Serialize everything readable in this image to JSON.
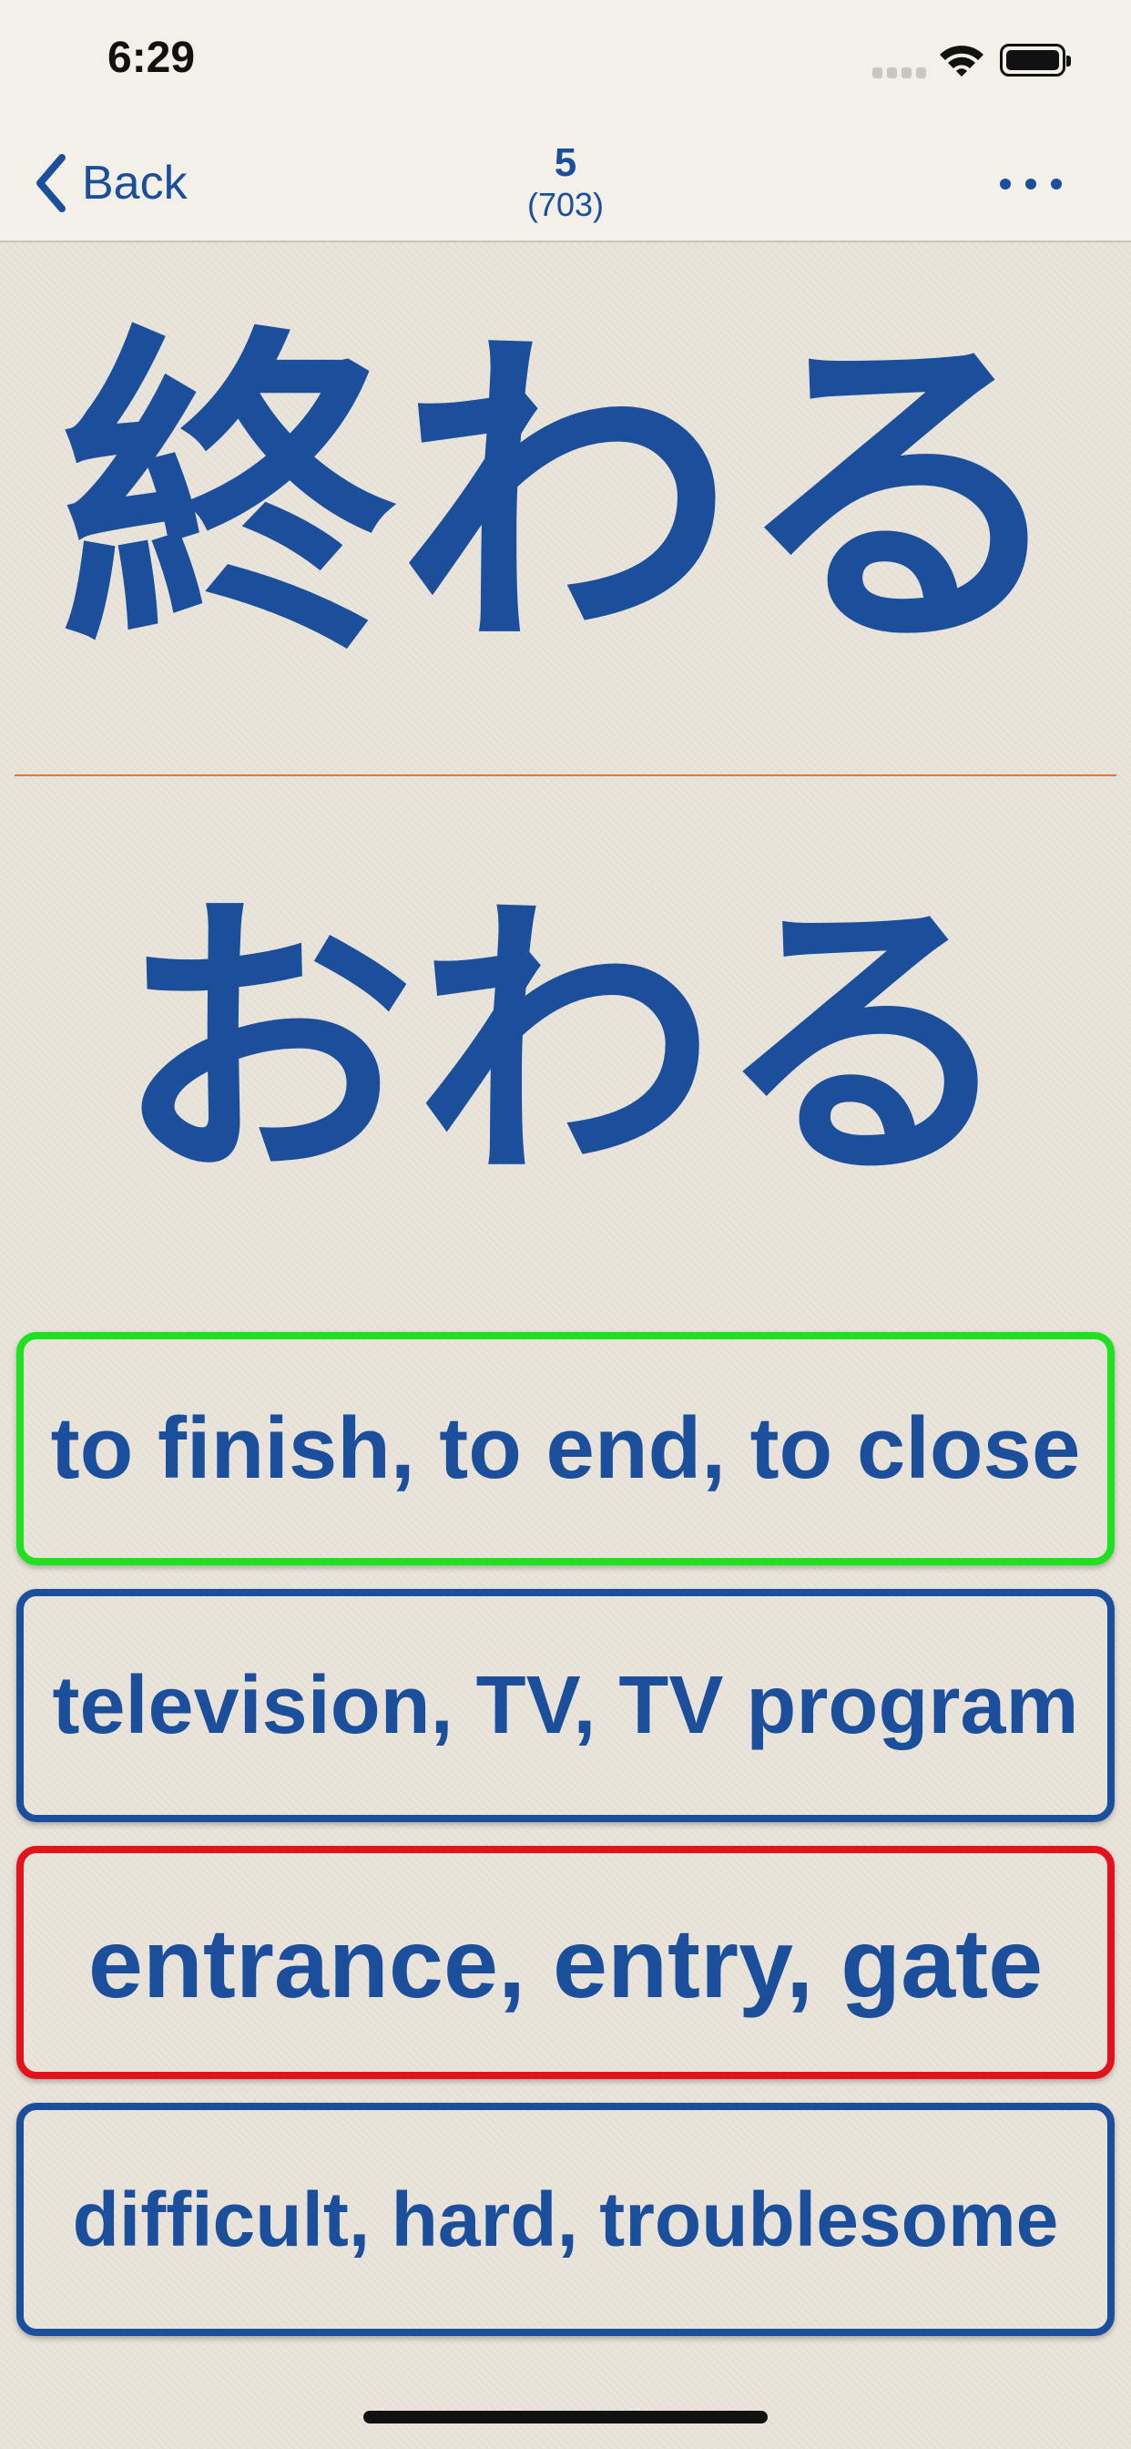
{
  "status": {
    "time": "6:29"
  },
  "nav": {
    "back_label": "Back",
    "card_number": "5",
    "card_total": "(703)"
  },
  "card": {
    "kanji": "終わる",
    "kana": "おわる"
  },
  "answers": [
    {
      "text": "to finish, to end, to close",
      "state": "correct",
      "border_color": "#1fe11f"
    },
    {
      "text": "television, TV, TV program",
      "state": "neutral",
      "border_color": "#1b4f9c"
    },
    {
      "text": "entrance, entry, gate",
      "state": "wrong",
      "border_color": "#e2141b"
    },
    {
      "text": "difficult, hard, troublesome",
      "state": "neutral",
      "border_color": "#1b4f9c"
    }
  ],
  "colors": {
    "accent": "#1b4f9c",
    "divider": "#e07a2e",
    "background": "#ece6de"
  },
  "icons": [
    "chevron-left-icon",
    "more-horizontal-icon",
    "wifi-icon",
    "battery-icon",
    "cellular-signal-icon"
  ]
}
